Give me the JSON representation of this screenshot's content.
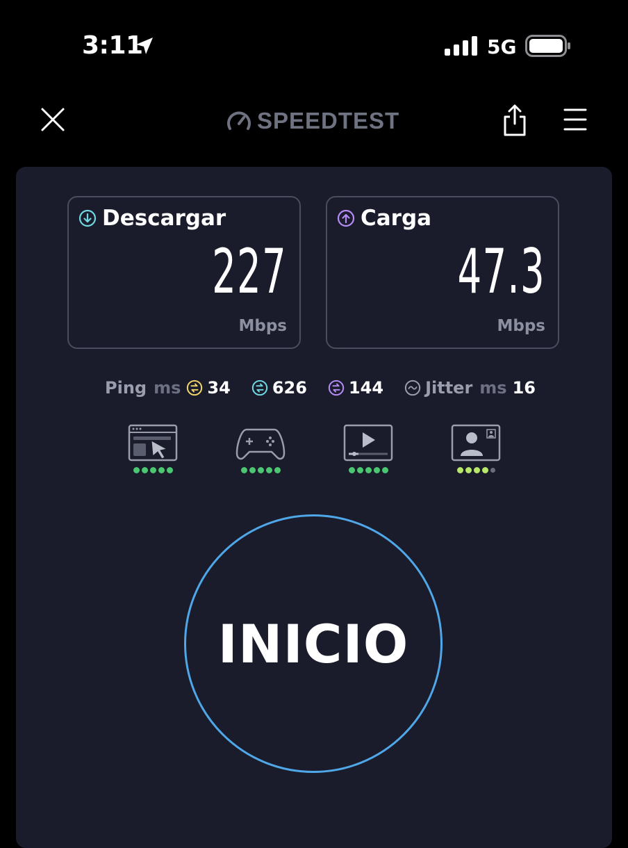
{
  "status_bar": {
    "time": "3:11",
    "network": "5G",
    "location_icon": "location-arrow-icon",
    "signal_icon": "signal-bars-icon",
    "battery_icon": "battery-icon"
  },
  "header": {
    "brand": "SPEEDTEST",
    "close_icon": "close-icon",
    "share_icon": "share-icon",
    "menu_icon": "hamburger-menu-icon"
  },
  "results": {
    "download": {
      "label": "Descargar",
      "value": "227",
      "unit": "Mbps",
      "color": "#6fd8e0"
    },
    "upload": {
      "label": "Carga",
      "value": "47.3",
      "unit": "Mbps",
      "color": "#b58cf5"
    }
  },
  "ping": {
    "label": "Ping",
    "unit": "ms",
    "idle": "34",
    "download": "626",
    "upload": "144",
    "jitter_label": "Jitter",
    "jitter_unit": "ms",
    "jitter": "16",
    "colors": {
      "idle": "#f0d56a",
      "download": "#6fd8e0",
      "upload": "#b58cf5",
      "jitter": "#9a9dad"
    }
  },
  "quality": [
    {
      "name": "browsing",
      "icon": "web-browsing-icon",
      "rating": 5
    },
    {
      "name": "gaming",
      "icon": "gamepad-icon",
      "rating": 5
    },
    {
      "name": "streaming",
      "icon": "video-stream-icon",
      "rating": 5
    },
    {
      "name": "video-call",
      "icon": "video-call-icon",
      "rating": 4
    }
  ],
  "start_button": {
    "label": "INICIO",
    "ring_color": "#4fa7e8"
  }
}
